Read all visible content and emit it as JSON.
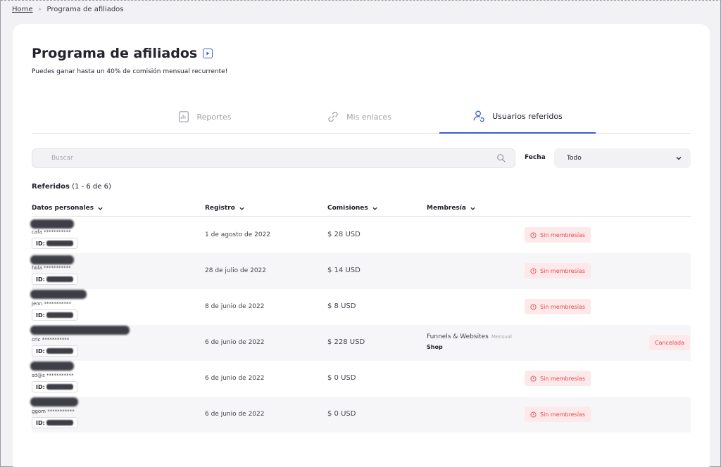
{
  "breadcrumb": {
    "home": "Home",
    "current": "Programa de afiliados"
  },
  "page": {
    "title": "Programa de afiliados",
    "subtitle": "Puedes ganar hasta un 40% de comisión mensual recurrente!"
  },
  "tabs": [
    {
      "label": "Reportes",
      "active": false
    },
    {
      "label": "Mis enlaces",
      "active": false
    },
    {
      "label": "Usuarios referidos",
      "active": true
    }
  ],
  "search": {
    "placeholder": "Buscar"
  },
  "filter": {
    "label": "Fecha",
    "value": "Todo"
  },
  "referrals": {
    "title": "Referidos",
    "range": "(1 - 6 de 6)"
  },
  "columns": {
    "personal": "Datos personales",
    "registro": "Registro",
    "comisiones": "Comisiones",
    "membresia": "Membresía"
  },
  "rows": [
    {
      "email": "cafa ***********",
      "id_label": "ID:",
      "date": "1 de agosto de 2022",
      "commission": "$ 28 USD",
      "status": "Sin membresías"
    },
    {
      "email": "hola ***********",
      "id_label": "ID:",
      "date": "28 de julio de 2022",
      "commission": "$ 14 USD",
      "status": "Sin membresías"
    },
    {
      "email": "jenn ***********",
      "id_label": "ID:",
      "date": "8 de junio de 2022",
      "commission": "$ 8 USD",
      "status": "Sin membresías"
    },
    {
      "email": "cric ***********",
      "id_label": "ID:",
      "date": "6 de junio de 2022",
      "commission": "$ 228 USD",
      "membership": "Funnels & Websites",
      "plan": "Mensual",
      "membership_sub": "Shop",
      "status": "Cancelada"
    },
    {
      "email": "sd@s ***********",
      "id_label": "ID:",
      "date": "6 de junio de 2022",
      "commission": "$ 0 USD",
      "status": "Sin membresías"
    },
    {
      "email": "ggom ***********",
      "id_label": "ID:",
      "date": "6 de junio de 2022",
      "commission": "$ 0 USD",
      "status": "Sin membresías"
    }
  ],
  "colors": {
    "accent": "#3b5bdb",
    "danger": "#e5484d",
    "danger_bg": "#fde9e9"
  }
}
